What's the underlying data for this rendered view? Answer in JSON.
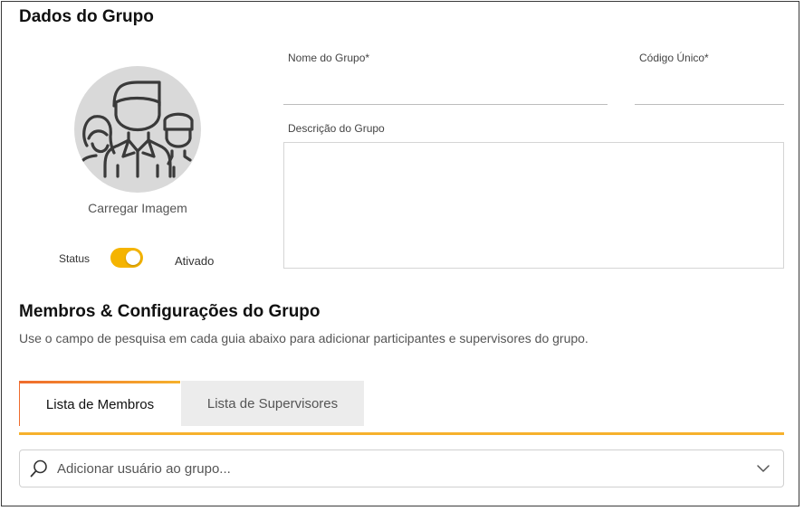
{
  "group_data": {
    "title": "Dados do Grupo",
    "avatar_icon": "group-people-icon",
    "upload_label": "Carregar Imagem",
    "status_label": "Status",
    "status_state": "Ativado",
    "status_on": true,
    "name_label": "Nome do Grupo*",
    "name_value": "",
    "code_label": "Código Único*",
    "code_value": "",
    "description_label": "Descrição do Grupo",
    "description_value": ""
  },
  "members_section": {
    "title": "Membros & Configurações do Grupo",
    "subtitle": "Use o campo de pesquisa em cada guia abaixo para adicionar participantes e supervisores do grupo.",
    "tabs": [
      {
        "label": "Lista de Membros",
        "active": true
      },
      {
        "label": "Lista de Supervisores",
        "active": false
      }
    ],
    "search_placeholder": "Adicionar usuário ao grupo...",
    "search_icon": "search-icon",
    "dropdown_icon": "chevron-down-icon"
  },
  "colors": {
    "accent": "#f6b12c",
    "accent_start": "#ef6b2d",
    "toggle_on": "#f5b400",
    "avatar_bg": "#d9d9d9",
    "inactive_tab_bg": "#ececec"
  }
}
